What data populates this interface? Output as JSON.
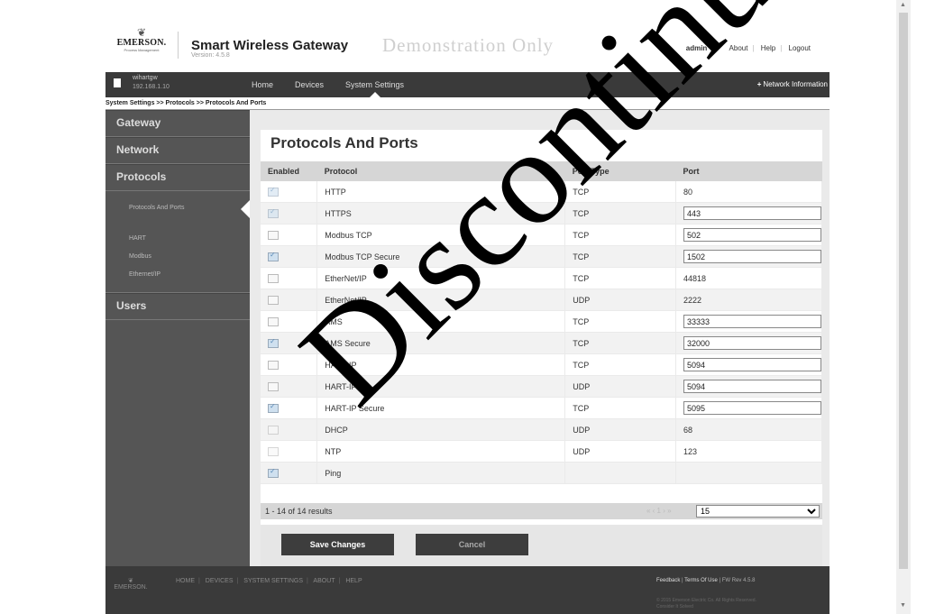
{
  "header": {
    "logo_brand": "EMERSON.",
    "logo_sub": "Process Management",
    "app_name": "Smart Wireless Gateway",
    "version": "Version: 4.5.8",
    "demo_text": "Demonstration Only",
    "user": "admin",
    "links": [
      "About",
      "Help",
      "Logout"
    ]
  },
  "navbar": {
    "gateway_name": "wihartgw",
    "gateway_ip": "192.168.1.10",
    "tabs": [
      "Home",
      "Devices",
      "System Settings"
    ],
    "active_tab": "System Settings",
    "network_info": "Network Information"
  },
  "breadcrumb": "System Settings >> Protocols >> Protocols And Ports",
  "sidebar": {
    "sections": [
      "Gateway",
      "Network",
      "Protocols",
      "Users"
    ],
    "protocol_items": [
      "Protocols And Ports",
      "HART",
      "Modbus",
      "Ethernet/IP"
    ],
    "active_item": "Protocols And Ports"
  },
  "main": {
    "title": "Protocols And Ports",
    "columns": [
      "Enabled",
      "Protocol",
      "Port Type",
      "Port"
    ],
    "rows": [
      {
        "enabled": true,
        "disabled": true,
        "protocol": "HTTP",
        "port_type": "TCP",
        "port": "80",
        "editable": false
      },
      {
        "enabled": true,
        "disabled": true,
        "protocol": "HTTPS",
        "port_type": "TCP",
        "port": "443",
        "editable": true
      },
      {
        "enabled": false,
        "disabled": false,
        "protocol": "Modbus TCP",
        "port_type": "TCP",
        "port": "502",
        "editable": true
      },
      {
        "enabled": true,
        "disabled": false,
        "protocol": "Modbus TCP Secure",
        "port_type": "TCP",
        "port": "1502",
        "editable": true
      },
      {
        "enabled": false,
        "disabled": false,
        "protocol": "EtherNet/IP",
        "port_type": "TCP",
        "port": "44818",
        "editable": false
      },
      {
        "enabled": false,
        "disabled": false,
        "protocol": "EtherNet/IP",
        "port_type": "UDP",
        "port": "2222",
        "editable": false
      },
      {
        "enabled": false,
        "disabled": false,
        "protocol": "AMS",
        "port_type": "TCP",
        "port": "33333",
        "editable": true
      },
      {
        "enabled": true,
        "disabled": false,
        "protocol": "AMS Secure",
        "port_type": "TCP",
        "port": "32000",
        "editable": true
      },
      {
        "enabled": false,
        "disabled": false,
        "protocol": "HART-IP",
        "port_type": "TCP",
        "port": "5094",
        "editable": true
      },
      {
        "enabled": false,
        "disabled": false,
        "protocol": "HART-IP",
        "port_type": "UDP",
        "port": "5094",
        "editable": true
      },
      {
        "enabled": true,
        "disabled": false,
        "protocol": "HART-IP Secure",
        "port_type": "TCP",
        "port": "5095",
        "editable": true
      },
      {
        "enabled": false,
        "disabled": true,
        "protocol": "DHCP",
        "port_type": "UDP",
        "port": "68",
        "editable": false
      },
      {
        "enabled": false,
        "disabled": true,
        "protocol": "NTP",
        "port_type": "UDP",
        "port": "123",
        "editable": false
      },
      {
        "enabled": true,
        "disabled": false,
        "protocol": "Ping",
        "port_type": "",
        "port": "",
        "editable": false
      }
    ],
    "results": "1 - 14 of 14 results",
    "pager_nav": "« ‹ 1 › »",
    "page_size": "15",
    "save_label": "Save Changes",
    "cancel_label": "Cancel"
  },
  "footer": {
    "links": [
      "HOME",
      "DEVICES",
      "SYSTEM SETTINGS",
      "ABOUT",
      "HELP"
    ],
    "right_links": [
      "Feedback",
      "Terms Of Use"
    ],
    "fw": "FW Rev 4.5.8",
    "copyright": "© 2015 Emerson Electric Co. All Rights Reserved.",
    "copyright2": "Consider It Solved"
  },
  "watermark": "Discontinued",
  "colors": {
    "navbar": "#3a3a3a",
    "sidebar": "#555555",
    "header_row": "#d6d6d6"
  }
}
